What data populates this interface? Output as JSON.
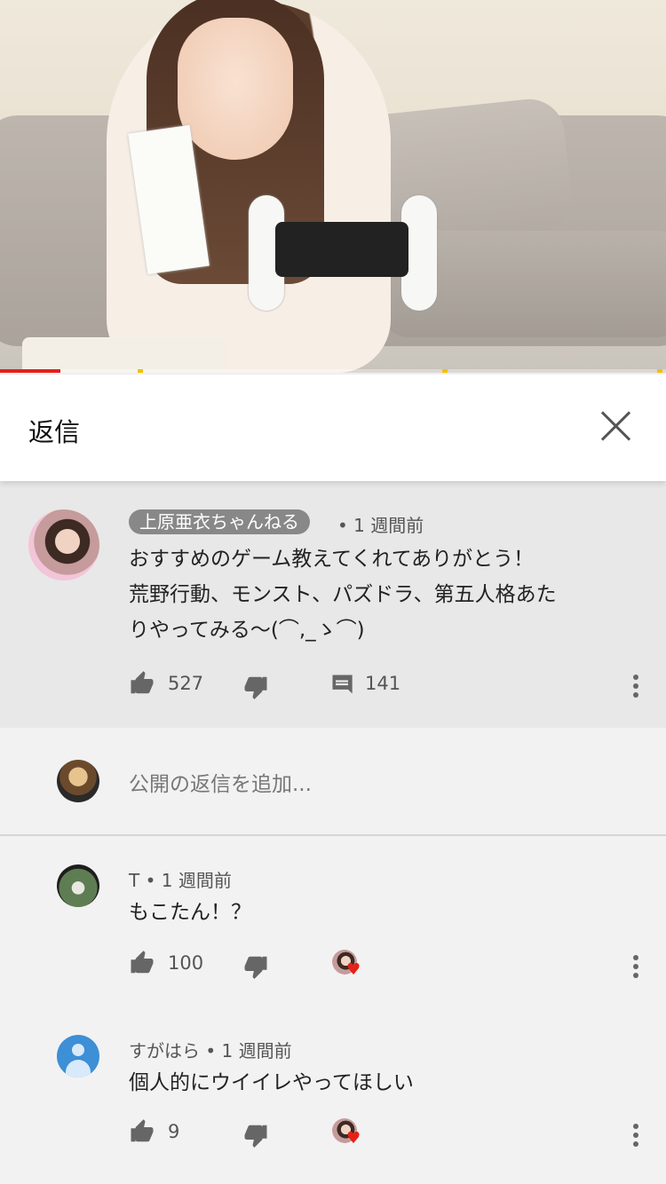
{
  "header": {
    "title": "返信",
    "close_icon": "close-icon"
  },
  "main_comment": {
    "channel": "上原亜衣ちゃんねる",
    "time": "• 1 週間前",
    "text_lines": [
      "おすすめのゲーム教えてくれてありがとう！",
      "荒野行動、モンスト、パズドラ、第五人格あた",
      "りやってみる〜(⌒,_ゝ⌒)"
    ],
    "likes": "527",
    "replies": "141"
  },
  "add_reply": {
    "placeholder": "公開の返信を追加..."
  },
  "replies": [
    {
      "author": "T",
      "time": "• 1 週間前",
      "text": "もこたん！？",
      "likes": "100"
    },
    {
      "author": "すがはら",
      "time": "• 1 週間前",
      "text": "個人的にウイイレやってほしい",
      "likes": "9"
    }
  ],
  "colors": {
    "accent": "#e62117",
    "progress_marker": "#f3c000",
    "main_comment_bg": "#e8e8e8",
    "page_bg": "#f2f2f2"
  },
  "video": {
    "progress_fraction": 0.09
  }
}
